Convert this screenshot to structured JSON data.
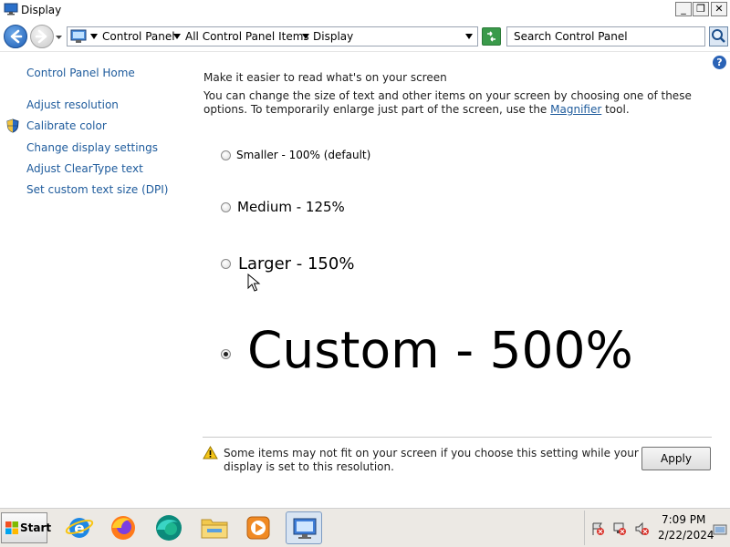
{
  "window": {
    "title": "Display",
    "minimize_glyph": "_",
    "maximize_glyph": "❐",
    "close_glyph": "✕"
  },
  "address_bar": {
    "breadcrumbs": [
      "Control Panel",
      "All Control Panel Items",
      "Display"
    ],
    "search_placeholder": "Search Control Panel"
  },
  "sidebar": {
    "home": "Control Panel Home",
    "items": [
      {
        "label": "Adjust resolution"
      },
      {
        "label": "Calibrate color",
        "icon": "uac-shield-icon"
      },
      {
        "label": "Change display settings"
      },
      {
        "label": "Adjust ClearType text"
      },
      {
        "label": "Set custom text size (DPI)"
      }
    ]
  },
  "main": {
    "help_glyph": "?",
    "heading": "Make it easier to read what's on your screen",
    "description_before": "You can change the size of text and other items on your screen by choosing one of these options. To temporarily enlarge just part of the screen, use the ",
    "magnifier_link": "Magnifier",
    "description_after": " tool.",
    "options": [
      {
        "label": "Smaller - 100% (default)",
        "checked": false
      },
      {
        "label": "Medium - 125%",
        "checked": false
      },
      {
        "label": "Larger - 150%",
        "checked": false
      },
      {
        "label": "Custom - 500%",
        "checked": true
      }
    ],
    "warning": "Some items may not fit on your screen if you choose this setting while your display is set to this resolution.",
    "apply_button": "Apply"
  },
  "taskbar": {
    "start_label": "Start",
    "apps": [
      "internet-explorer-icon",
      "firefox-icon",
      "edge-icon",
      "file-explorer-icon",
      "media-player-icon",
      "control-panel-display-icon"
    ],
    "clock_time": "7:09 PM",
    "clock_date": "2/22/2024"
  },
  "colors": {
    "link": "#1e5b9c",
    "text": "#1e1e1e",
    "taskbar": "#ece9e4"
  }
}
